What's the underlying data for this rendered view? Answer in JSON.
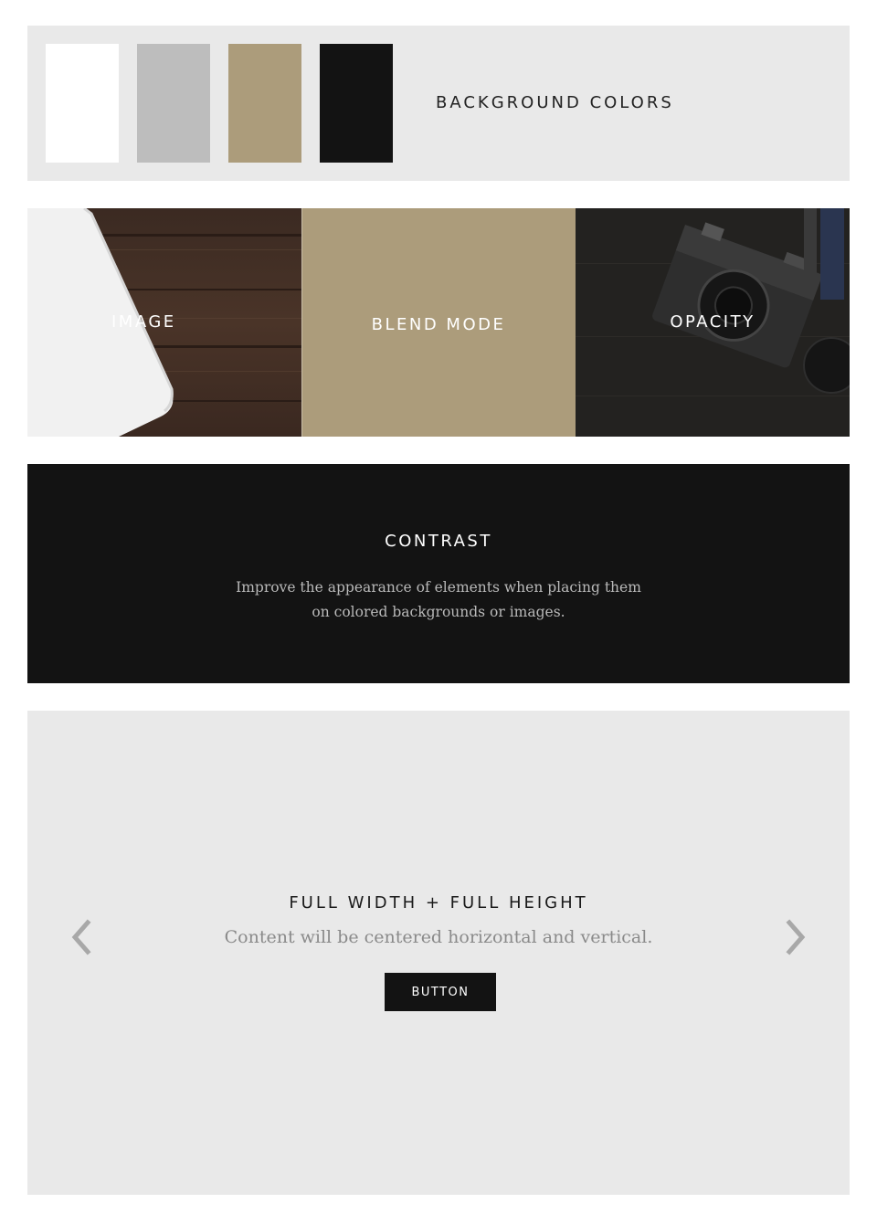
{
  "background_colors": {
    "title": "BACKGROUND COLORS",
    "swatches": [
      "#ffffff",
      "#bdbdbd",
      "#ac9c7b",
      "#131313"
    ]
  },
  "tiles": [
    {
      "label": "IMAGE"
    },
    {
      "label": "BLEND MODE"
    },
    {
      "label": "OPACITY"
    }
  ],
  "contrast": {
    "title": "CONTRAST",
    "text_line1": "Improve the appearance of elements when placing them",
    "text_line2": "on colored backgrounds or images."
  },
  "hero": {
    "title": "FULL WIDTH + FULL HEIGHT",
    "subtitle": "Content will be centered horizontal and vertical.",
    "button_label": "BUTTON",
    "prev_icon": "chevron-left-icon",
    "next_icon": "chevron-right-icon"
  }
}
